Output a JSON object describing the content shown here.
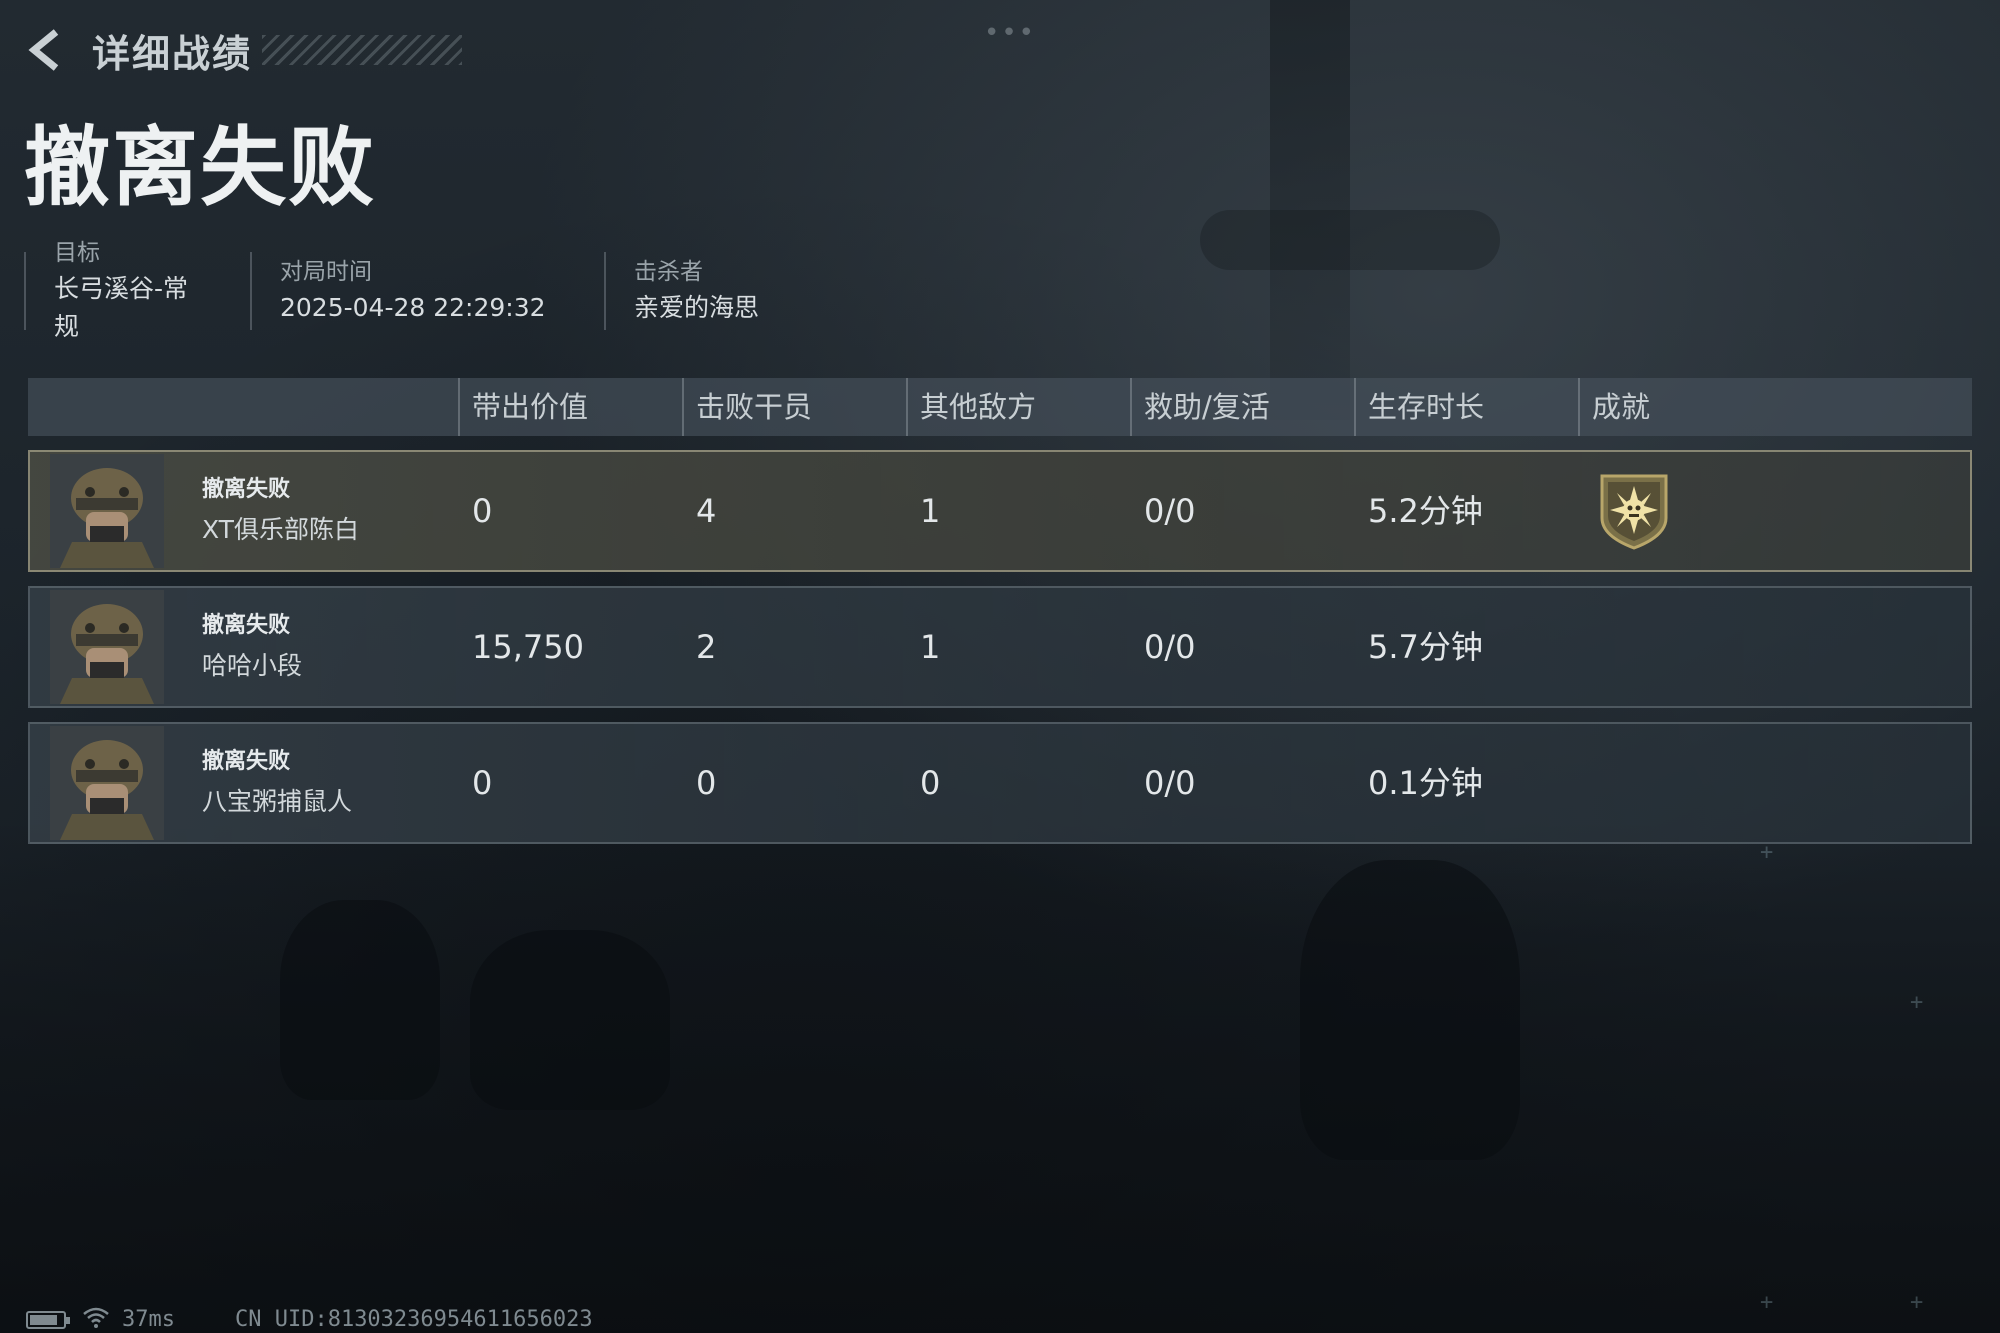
{
  "header": {
    "back_title": "详细战绩",
    "page_title": "撤离失败"
  },
  "info": [
    {
      "label": "目标",
      "value": "长弓溪谷-常规"
    },
    {
      "label": "对局时间",
      "value": "2025-04-28 22:29:32"
    },
    {
      "label": "击杀者",
      "value": "亲爱的海思"
    }
  ],
  "table": {
    "columns": [
      "带出价值",
      "击败干员",
      "其他敌方",
      "救助/复活",
      "生存时长",
      "成就"
    ],
    "rows": [
      {
        "status": "撤离失败",
        "name": "XT俱乐部陈白",
        "value": "0",
        "kills": "4",
        "other": "1",
        "assist": "0/0",
        "survival": "5.2分钟",
        "achievement_icon": "achievement-badge-icon",
        "highlighted": true
      },
      {
        "status": "撤离失败",
        "name": "哈哈小段",
        "value": "15,750",
        "kills": "2",
        "other": "1",
        "assist": "0/0",
        "survival": "5.7分钟",
        "achievement_icon": "",
        "highlighted": false
      },
      {
        "status": "撤离失败",
        "name": "八宝粥捕鼠人",
        "value": "0",
        "kills": "0",
        "other": "0",
        "assist": "0/0",
        "survival": "0.1分钟",
        "achievement_icon": "",
        "highlighted": false
      }
    ]
  },
  "footer": {
    "battery_level": 0.85,
    "ping": "37ms",
    "uid": "CN UID:8130323695461165​6023"
  },
  "colors": {
    "highlight_border": "#aaa58c",
    "badge": "#b8a66a"
  }
}
